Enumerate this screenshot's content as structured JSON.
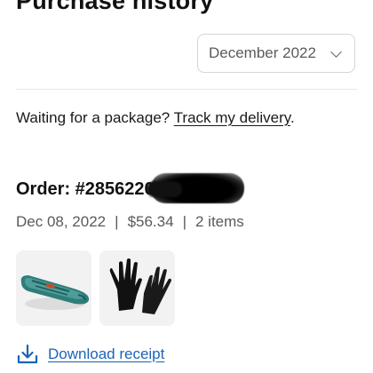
{
  "header": {
    "title": "Purchase history"
  },
  "filter": {
    "selected_month": "December 2022",
    "icon": "chevron-down-icon"
  },
  "notice": {
    "prefix": "Waiting for a package? ",
    "link_text": "Track my delivery",
    "suffix": "."
  },
  "order": {
    "title_prefix": "Order: #2856220",
    "date": "Dec 08, 2022",
    "total": "$56.34",
    "item_count": "2 items",
    "separator": "|",
    "items": [
      {
        "name": "sled-thumbnail",
        "icon": "snow-sled-image"
      },
      {
        "name": "gloves-thumbnail",
        "icon": "gloves-image"
      }
    ]
  },
  "receipt": {
    "label": "Download receipt",
    "icon": "download-icon",
    "link_color": "#1b64b8"
  }
}
